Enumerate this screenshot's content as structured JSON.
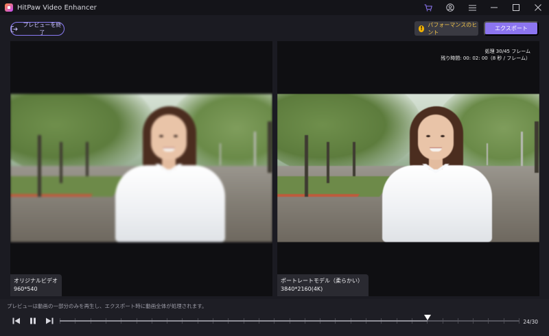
{
  "window": {
    "title": "HitPaw Video Enhancer",
    "icons": [
      "cart-icon",
      "account-icon",
      "menu-icon",
      "minimize-icon",
      "maximize-icon",
      "close-icon"
    ]
  },
  "toolbar": {
    "exit_preview_label": "プレビューを終了",
    "performance_hint_label": "パフォーマンスのヒント",
    "export_label": "エクスポート"
  },
  "left_panel": {
    "label": "オリジナルビデオ",
    "resolution": "960*540"
  },
  "right_panel": {
    "progress": "処理 30/45 フレーム",
    "remaining": "残り時間: 00: 02: 00（8 秒 / フレーム）",
    "label": "ポートレートモデル（柔らかい）",
    "resolution": "3840*2160(4K)"
  },
  "footer": {
    "notice": "プレビューは動画の一部分のみを再生し、エクスポート時に動画全体が処理されます。",
    "counter": "24/30",
    "current_frame": 24,
    "total_frames": 30
  },
  "colors": {
    "accent": "#8c75f0",
    "hint": "#f0c34a",
    "background": "#1b1b22"
  }
}
